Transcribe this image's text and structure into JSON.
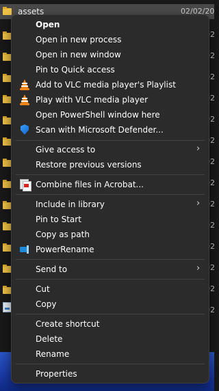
{
  "explorer": {
    "selected_item_name": "assets",
    "selected_item_date": "02/02/20",
    "side_date_fragment": "02"
  },
  "context_menu": {
    "items": [
      {
        "label": "Open",
        "bold": true,
        "icon": ""
      },
      {
        "label": "Open in new process",
        "icon": ""
      },
      {
        "label": "Open in new window",
        "icon": ""
      },
      {
        "label": "Pin to Quick access",
        "icon": ""
      },
      {
        "label": "Add to VLC media player's Playlist",
        "icon": "vlc-icon"
      },
      {
        "label": "Play with VLC media player",
        "icon": "vlc-icon"
      },
      {
        "label": "Open PowerShell window here",
        "icon": ""
      },
      {
        "label": "Scan with Microsoft Defender...",
        "icon": "defender-shield-icon"
      },
      {
        "label": "Give access to",
        "icon": "",
        "submenu": true
      },
      {
        "label": "Restore previous versions",
        "icon": ""
      },
      {
        "label": "Combine files in Acrobat...",
        "icon": "acrobat-combine-icon"
      },
      {
        "label": "Include in library",
        "icon": "",
        "submenu": true
      },
      {
        "label": "Pin to Start",
        "icon": ""
      },
      {
        "label": "Copy as path",
        "icon": ""
      },
      {
        "label": "PowerRename",
        "icon": "powerrename-icon"
      },
      {
        "label": "Send to",
        "icon": "",
        "submenu": true
      },
      {
        "label": "Cut",
        "icon": ""
      },
      {
        "label": "Copy",
        "icon": ""
      },
      {
        "label": "Create shortcut",
        "icon": ""
      },
      {
        "label": "Delete",
        "icon": ""
      },
      {
        "label": "Rename",
        "icon": ""
      },
      {
        "label": "Properties",
        "icon": ""
      }
    ],
    "submenu_glyph": "›"
  },
  "colors": {
    "menu_background": "#2b2b2b",
    "separator": "#424242",
    "folder_yellow": "#f0c246",
    "vlc_orange": "#f08519",
    "defender_blue": "#1463c7",
    "acrobat_red": "#d8231f"
  }
}
